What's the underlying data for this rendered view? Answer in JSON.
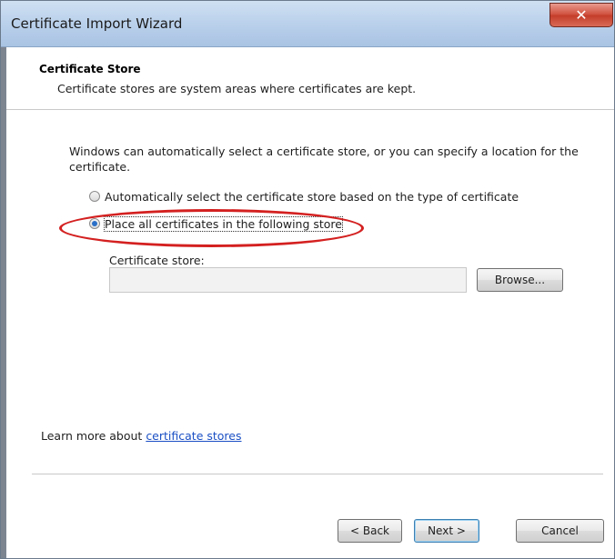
{
  "window": {
    "title": "Certificate Import Wizard",
    "close_glyph": "✕"
  },
  "header": {
    "section_title": "Certificate Store",
    "section_desc": "Certificate stores are system areas where certificates are kept."
  },
  "main": {
    "intro_text": "Windows can automatically select a certificate store, or you can specify a location for the certificate.",
    "options": [
      {
        "label": "Automatically select the certificate store based on the type of certificate",
        "selected": false
      },
      {
        "label": "Place all certificates in the following store",
        "selected": true
      }
    ],
    "store_label": "Certificate store:",
    "store_value": "",
    "browse_label": "Browse...",
    "learn_prefix": "Learn more about ",
    "learn_link": "certificate stores"
  },
  "footer": {
    "back_label": "< Back",
    "next_label": "Next >",
    "cancel_label": "Cancel"
  },
  "colors": {
    "annotation_ellipse": "#d42020",
    "link": "#1a4fc4",
    "close_button": "#c43d2a"
  }
}
